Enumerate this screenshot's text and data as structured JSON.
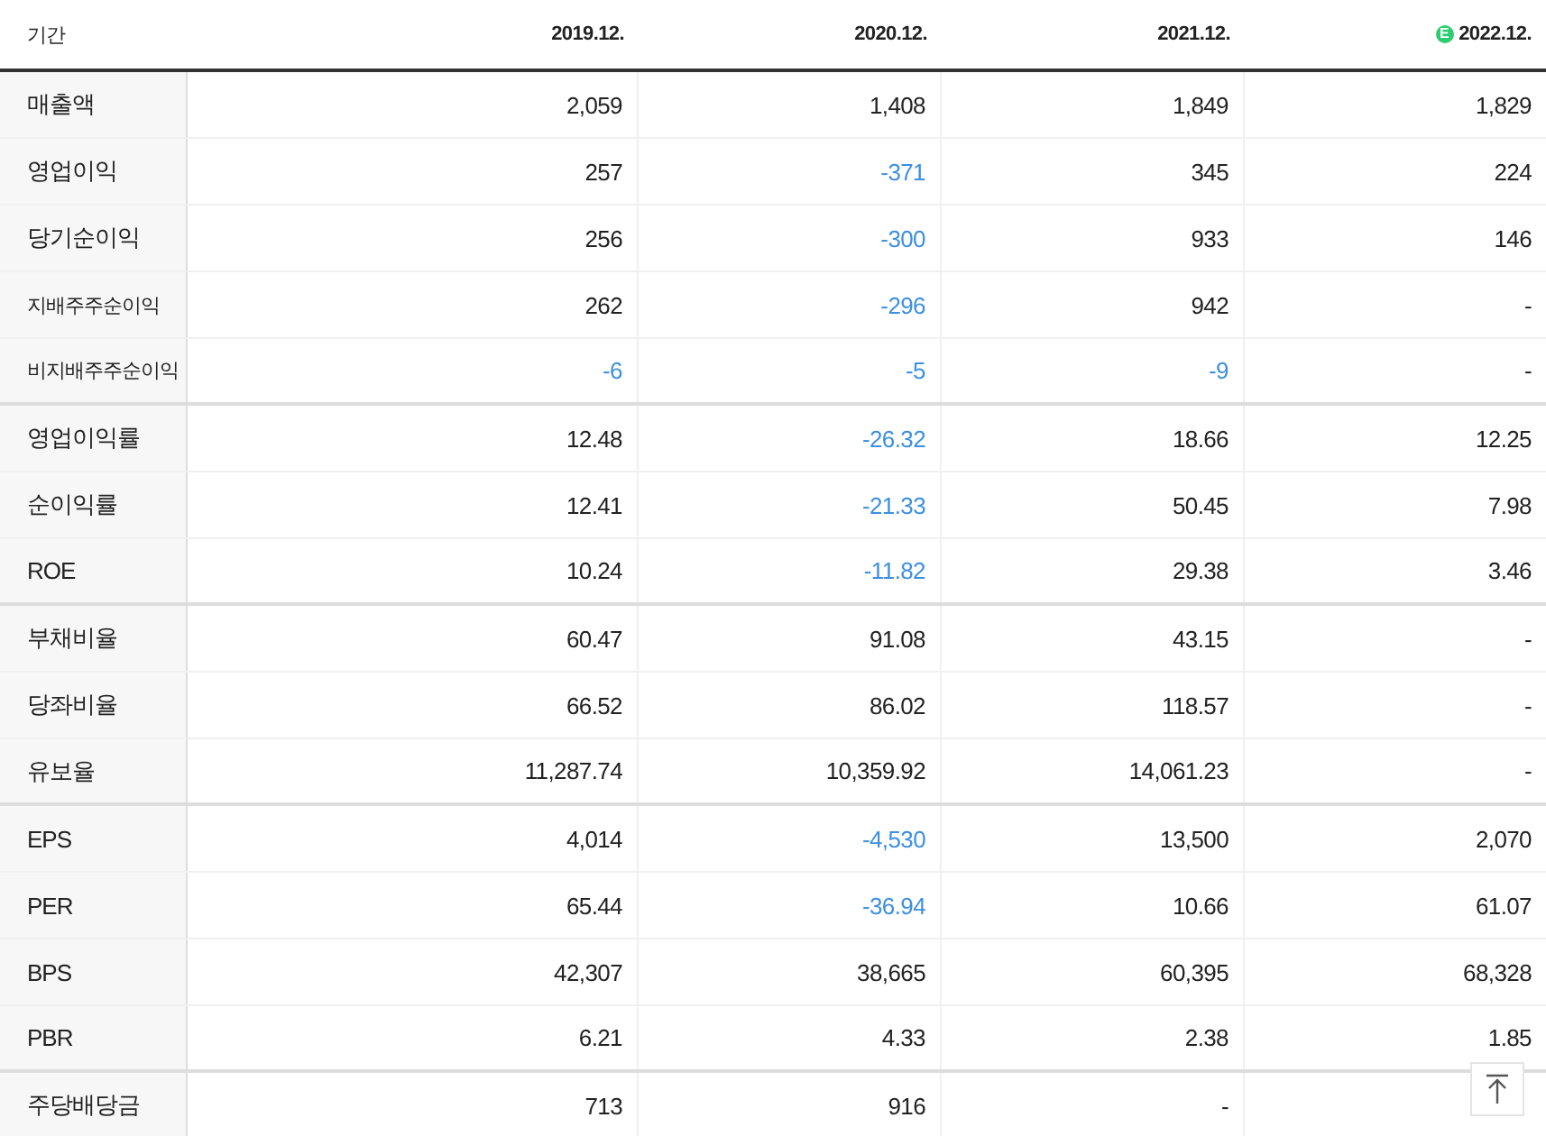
{
  "table": {
    "label_header": "기간",
    "columns": [
      {
        "label": "2019.12."
      },
      {
        "label": "2020.12."
      },
      {
        "label": "2021.12."
      },
      {
        "label": "2022.12.",
        "badge": "E"
      }
    ],
    "rows": [
      {
        "label": "매출액",
        "kind": "main",
        "group_end": false,
        "cells": [
          {
            "text": "2,059",
            "negative": false
          },
          {
            "text": "1,408",
            "negative": false
          },
          {
            "text": "1,849",
            "negative": false
          },
          {
            "text": "1,829",
            "negative": false
          }
        ]
      },
      {
        "label": "영업이익",
        "kind": "main",
        "group_end": false,
        "cells": [
          {
            "text": "257",
            "negative": false
          },
          {
            "text": "-371",
            "negative": true
          },
          {
            "text": "345",
            "negative": false
          },
          {
            "text": "224",
            "negative": false
          }
        ]
      },
      {
        "label": "당기순이익",
        "kind": "main",
        "group_end": false,
        "cells": [
          {
            "text": "256",
            "negative": false
          },
          {
            "text": "-300",
            "negative": true
          },
          {
            "text": "933",
            "negative": false
          },
          {
            "text": "146",
            "negative": false
          }
        ]
      },
      {
        "label": "지배주주순이익",
        "kind": "sub",
        "group_end": false,
        "cells": [
          {
            "text": "262",
            "negative": false
          },
          {
            "text": "-296",
            "negative": true
          },
          {
            "text": "942",
            "negative": false
          },
          {
            "text": "-",
            "negative": false
          }
        ]
      },
      {
        "label": "비지배주주순이익",
        "kind": "sub",
        "group_end": true,
        "cells": [
          {
            "text": "-6",
            "negative": true
          },
          {
            "text": "-5",
            "negative": true
          },
          {
            "text": "-9",
            "negative": true
          },
          {
            "text": "-",
            "negative": false
          }
        ]
      },
      {
        "label": "영업이익률",
        "kind": "main",
        "group_end": false,
        "cells": [
          {
            "text": "12.48",
            "negative": false
          },
          {
            "text": "-26.32",
            "negative": true
          },
          {
            "text": "18.66",
            "negative": false
          },
          {
            "text": "12.25",
            "negative": false
          }
        ]
      },
      {
        "label": "순이익률",
        "kind": "main",
        "group_end": false,
        "cells": [
          {
            "text": "12.41",
            "negative": false
          },
          {
            "text": "-21.33",
            "negative": true
          },
          {
            "text": "50.45",
            "negative": false
          },
          {
            "text": "7.98",
            "negative": false
          }
        ]
      },
      {
        "label": "ROE",
        "kind": "main",
        "group_end": true,
        "cells": [
          {
            "text": "10.24",
            "negative": false
          },
          {
            "text": "-11.82",
            "negative": true
          },
          {
            "text": "29.38",
            "negative": false
          },
          {
            "text": "3.46",
            "negative": false
          }
        ]
      },
      {
        "label": "부채비율",
        "kind": "main",
        "group_end": false,
        "cells": [
          {
            "text": "60.47",
            "negative": false
          },
          {
            "text": "91.08",
            "negative": false
          },
          {
            "text": "43.15",
            "negative": false
          },
          {
            "text": "-",
            "negative": false
          }
        ]
      },
      {
        "label": "당좌비율",
        "kind": "main",
        "group_end": false,
        "cells": [
          {
            "text": "66.52",
            "negative": false
          },
          {
            "text": "86.02",
            "negative": false
          },
          {
            "text": "118.57",
            "negative": false
          },
          {
            "text": "-",
            "negative": false
          }
        ]
      },
      {
        "label": "유보율",
        "kind": "main",
        "group_end": true,
        "cells": [
          {
            "text": "11,287.74",
            "negative": false
          },
          {
            "text": "10,359.92",
            "negative": false
          },
          {
            "text": "14,061.23",
            "negative": false
          },
          {
            "text": "-",
            "negative": false
          }
        ]
      },
      {
        "label": "EPS",
        "kind": "main",
        "group_end": false,
        "cells": [
          {
            "text": "4,014",
            "negative": false
          },
          {
            "text": "-4,530",
            "negative": true
          },
          {
            "text": "13,500",
            "negative": false
          },
          {
            "text": "2,070",
            "negative": false
          }
        ]
      },
      {
        "label": "PER",
        "kind": "main",
        "group_end": false,
        "cells": [
          {
            "text": "65.44",
            "negative": false
          },
          {
            "text": "-36.94",
            "negative": true
          },
          {
            "text": "10.66",
            "negative": false
          },
          {
            "text": "61.07",
            "negative": false
          }
        ]
      },
      {
        "label": "BPS",
        "kind": "main",
        "group_end": false,
        "cells": [
          {
            "text": "42,307",
            "negative": false
          },
          {
            "text": "38,665",
            "negative": false
          },
          {
            "text": "60,395",
            "negative": false
          },
          {
            "text": "68,328",
            "negative": false
          }
        ]
      },
      {
        "label": "PBR",
        "kind": "main",
        "group_end": true,
        "cells": [
          {
            "text": "6.21",
            "negative": false
          },
          {
            "text": "4.33",
            "negative": false
          },
          {
            "text": "2.38",
            "negative": false
          },
          {
            "text": "1.85",
            "negative": false
          }
        ]
      },
      {
        "label": "주당배당금",
        "kind": "main",
        "group_end": false,
        "cells": [
          {
            "text": "713",
            "negative": false
          },
          {
            "text": "916",
            "negative": false
          },
          {
            "text": "-",
            "negative": false
          },
          null
        ]
      }
    ]
  }
}
